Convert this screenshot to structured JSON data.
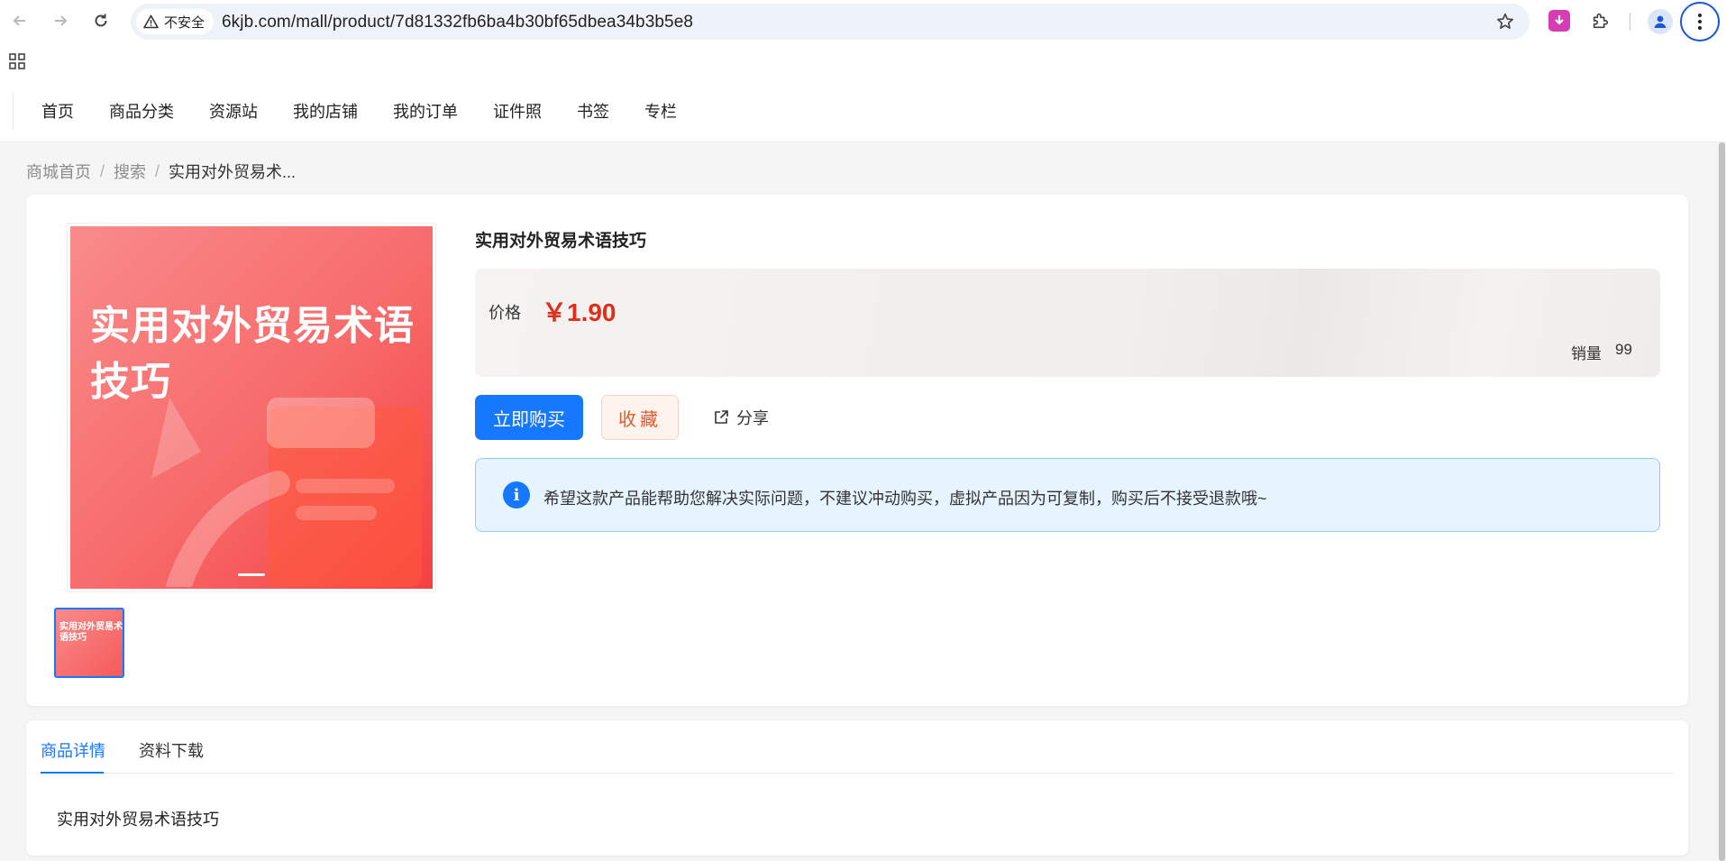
{
  "browser": {
    "security_label": "不安全",
    "url": "6kjb.com/mall/product/7d81332fb6ba4b30bf65dbea34b3b5e8"
  },
  "site_nav": [
    "首页",
    "商品分类",
    "资源站",
    "我的店铺",
    "我的订单",
    "证件照",
    "书签",
    "专栏"
  ],
  "breadcrumb": {
    "home": "商城首页",
    "search": "搜索",
    "current": "实用对外贸易术..."
  },
  "product": {
    "cover_text": "实用对外贸易术语技巧",
    "thumb_text": "实用对外贸易术语技巧",
    "title": "实用对外贸易术语技巧",
    "price_label": "价格",
    "price": "￥1.90",
    "sales_label": "销量",
    "sales": "99",
    "buy_label": "立即购买",
    "fav_label": "收藏",
    "share_label": "分享",
    "notice": "希望这款产品能帮助您解决实际问题，不建议冲动购买，虚拟产品因为可复制，购买后不接受退款哦~"
  },
  "detail": {
    "tabs": [
      "商品详情",
      "资料下载"
    ],
    "active_tab": "商品详情",
    "content": "实用对外贸易术语技巧"
  },
  "colors": {
    "primary": "#1677ff",
    "price": "#e02e1a",
    "favorite": "#e05a30"
  },
  "icons": [
    "back-icon",
    "forward-icon",
    "reload-icon",
    "warning-icon",
    "star-icon",
    "download-extension-icon",
    "puzzle-icon",
    "profile-icon",
    "more-vert-icon",
    "apps-grid-icon",
    "share-icon",
    "info-icon"
  ]
}
